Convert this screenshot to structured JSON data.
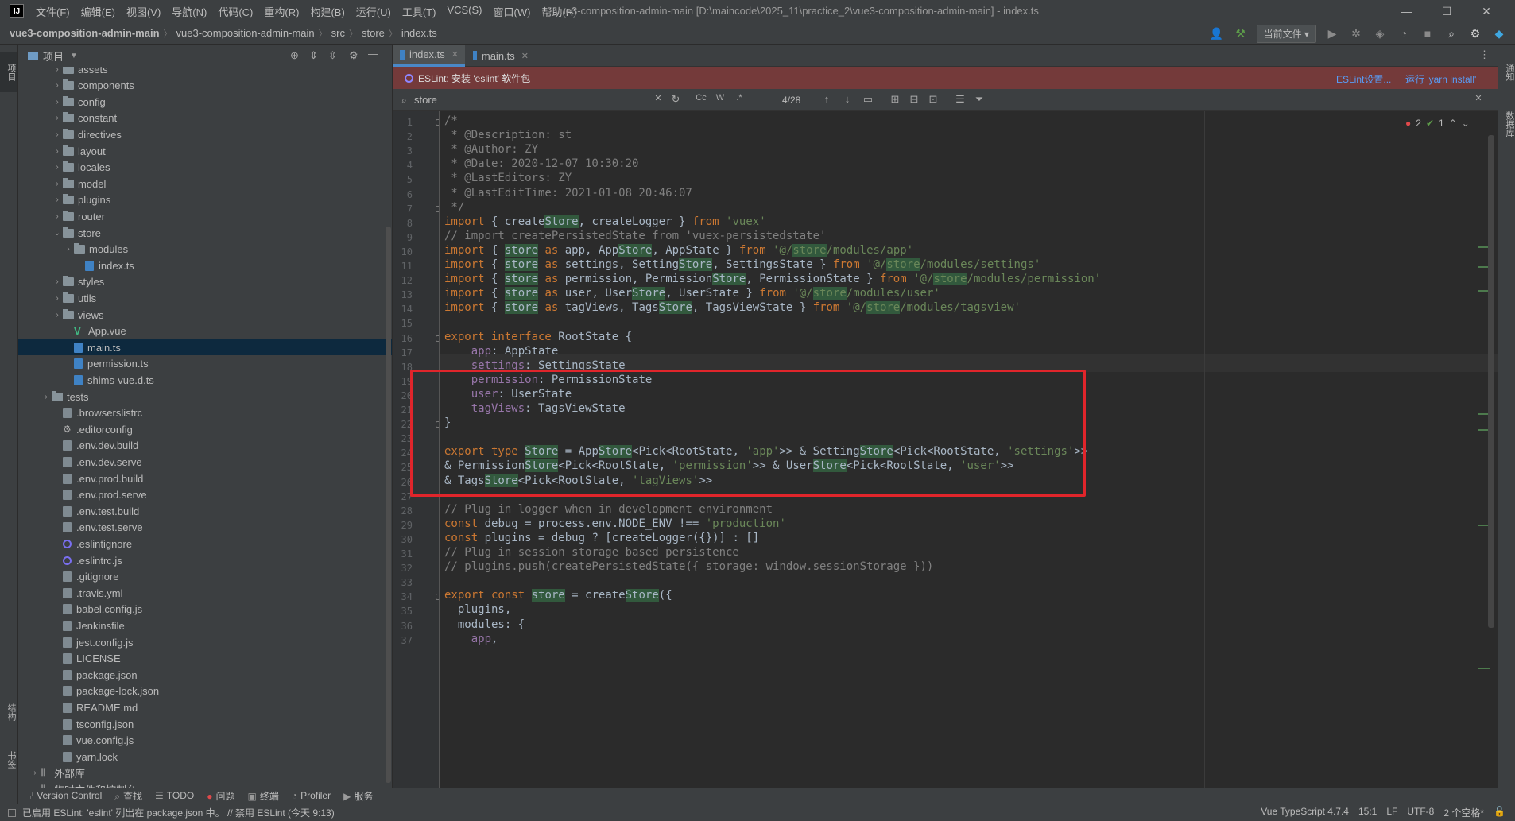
{
  "menu": [
    "文件(F)",
    "编辑(E)",
    "视图(V)",
    "导航(N)",
    "代码(C)",
    "重构(R)",
    "构建(B)",
    "运行(U)",
    "工具(T)",
    "VCS(S)",
    "窗口(W)",
    "帮助(H)"
  ],
  "window_title": "vue3-composition-admin-main [D:\\maincode\\2025_11\\practice_2\\vue3-composition-admin-main] - index.ts",
  "breadcrumb": [
    "vue3-composition-admin-main",
    "vue3-composition-admin-main",
    "src",
    "store",
    "index.ts"
  ],
  "run_config": "当前文件",
  "left_strip": {
    "top": "项目",
    "bottom1": "结构",
    "bottom2": "书签"
  },
  "project": {
    "title": "项目",
    "tree": [
      {
        "label": "assets",
        "kind": "folder",
        "depth": 2,
        "arrow": "›"
      },
      {
        "label": "components",
        "kind": "folder",
        "depth": 2,
        "arrow": "›"
      },
      {
        "label": "config",
        "kind": "folder",
        "depth": 2,
        "arrow": "›"
      },
      {
        "label": "constant",
        "kind": "folder",
        "depth": 2,
        "arrow": "›"
      },
      {
        "label": "directives",
        "kind": "folder",
        "depth": 2,
        "arrow": "›"
      },
      {
        "label": "layout",
        "kind": "folder",
        "depth": 2,
        "arrow": "›"
      },
      {
        "label": "locales",
        "kind": "folder",
        "depth": 2,
        "arrow": "›"
      },
      {
        "label": "model",
        "kind": "folder",
        "depth": 2,
        "arrow": "›"
      },
      {
        "label": "plugins",
        "kind": "folder",
        "depth": 2,
        "arrow": "›"
      },
      {
        "label": "router",
        "kind": "folder",
        "depth": 2,
        "arrow": "›"
      },
      {
        "label": "store",
        "kind": "folder",
        "depth": 2,
        "arrow": "⌄"
      },
      {
        "label": "modules",
        "kind": "folder",
        "depth": 3,
        "arrow": "›"
      },
      {
        "label": "index.ts",
        "kind": "ts",
        "depth": 4,
        "arrow": ""
      },
      {
        "label": "styles",
        "kind": "folder",
        "depth": 2,
        "arrow": "›"
      },
      {
        "label": "utils",
        "kind": "folder",
        "depth": 2,
        "arrow": "›"
      },
      {
        "label": "views",
        "kind": "folder",
        "depth": 2,
        "arrow": "›"
      },
      {
        "label": "App.vue",
        "kind": "vue",
        "depth": 3,
        "arrow": ""
      },
      {
        "label": "main.ts",
        "kind": "ts",
        "depth": 3,
        "arrow": "",
        "selected": true
      },
      {
        "label": "permission.ts",
        "kind": "ts",
        "depth": 3,
        "arrow": ""
      },
      {
        "label": "shims-vue.d.ts",
        "kind": "ts",
        "depth": 3,
        "arrow": ""
      },
      {
        "label": "tests",
        "kind": "folder",
        "depth": 1,
        "arrow": "›"
      },
      {
        "label": ".browserslistrc",
        "kind": "file",
        "depth": 2,
        "arrow": ""
      },
      {
        "label": ".editorconfig",
        "kind": "gear",
        "depth": 2,
        "arrow": ""
      },
      {
        "label": ".env.dev.build",
        "kind": "file",
        "depth": 2,
        "arrow": ""
      },
      {
        "label": ".env.dev.serve",
        "kind": "file",
        "depth": 2,
        "arrow": ""
      },
      {
        "label": ".env.prod.build",
        "kind": "file",
        "depth": 2,
        "arrow": ""
      },
      {
        "label": ".env.prod.serve",
        "kind": "file",
        "depth": 2,
        "arrow": ""
      },
      {
        "label": ".env.test.build",
        "kind": "file",
        "depth": 2,
        "arrow": ""
      },
      {
        "label": ".env.test.serve",
        "kind": "file",
        "depth": 2,
        "arrow": ""
      },
      {
        "label": ".eslintignore",
        "kind": "circle",
        "depth": 2,
        "arrow": ""
      },
      {
        "label": ".eslintrc.js",
        "kind": "circle",
        "depth": 2,
        "arrow": ""
      },
      {
        "label": ".gitignore",
        "kind": "file",
        "depth": 2,
        "arrow": ""
      },
      {
        "label": ".travis.yml",
        "kind": "file",
        "depth": 2,
        "arrow": ""
      },
      {
        "label": "babel.config.js",
        "kind": "file",
        "depth": 2,
        "arrow": ""
      },
      {
        "label": "Jenkinsfile",
        "kind": "file",
        "depth": 2,
        "arrow": ""
      },
      {
        "label": "jest.config.js",
        "kind": "file",
        "depth": 2,
        "arrow": ""
      },
      {
        "label": "LICENSE",
        "kind": "file",
        "depth": 2,
        "arrow": ""
      },
      {
        "label": "package.json",
        "kind": "file",
        "depth": 2,
        "arrow": ""
      },
      {
        "label": "package-lock.json",
        "kind": "file",
        "depth": 2,
        "arrow": ""
      },
      {
        "label": "README.md",
        "kind": "file",
        "depth": 2,
        "arrow": ""
      },
      {
        "label": "tsconfig.json",
        "kind": "file",
        "depth": 2,
        "arrow": ""
      },
      {
        "label": "vue.config.js",
        "kind": "file",
        "depth": 2,
        "arrow": ""
      },
      {
        "label": "yarn.lock",
        "kind": "file",
        "depth": 2,
        "arrow": ""
      },
      {
        "label": "外部库",
        "kind": "lib",
        "depth": 0,
        "arrow": "›"
      },
      {
        "label": "临时文件和控制台",
        "kind": "lib",
        "depth": 0,
        "arrow": "›"
      }
    ]
  },
  "tabs": [
    {
      "label": "index.ts",
      "active": true
    },
    {
      "label": "main.ts",
      "active": false
    }
  ],
  "eslint_bar": {
    "message": "ESLint: 安装 'eslint' 软件包",
    "settings_link": "ESLint设置...",
    "run_link": "运行 'yarn install'"
  },
  "find": {
    "query": "store",
    "count": "4/28"
  },
  "inspections": {
    "errors": "2",
    "warnings": "1"
  },
  "code_lines": [
    {
      "n": "1",
      "html": "<span class=\"cm\">/*</span>"
    },
    {
      "n": "2",
      "html": "<span class=\"cm\"> * @Description: st</span>"
    },
    {
      "n": "3",
      "html": "<span class=\"cm\"> * @Author: ZY</span>"
    },
    {
      "n": "4",
      "html": "<span class=\"cm\"> * @Date: 2020-12-07 10:30:20</span>"
    },
    {
      "n": "5",
      "html": "<span class=\"cm\"> * @LastEditors: ZY</span>"
    },
    {
      "n": "6",
      "html": "<span class=\"cm\"> * @LastEditTime: 2021-01-08 20:46:07</span>"
    },
    {
      "n": "7",
      "html": "<span class=\"cm\"> */</span>"
    },
    {
      "n": "8",
      "html": "<span class=\"kw\">import</span> { create<span class=\"hl\">Store</span>, createLogger } <span class=\"kw\">from</span> <span class=\"str\">'vuex'</span>"
    },
    {
      "n": "9",
      "html": "<span class=\"cm\">// import createPersistedState from 'vuex-persistedstate'</span>"
    },
    {
      "n": "10",
      "html": "<span class=\"kw\">import</span> { <span class=\"hl\">store</span> <span class=\"kw\">as</span> app, App<span class=\"hl\">Store</span>, AppState } <span class=\"kw\">from</span> <span class=\"str\">'@/<span class=\"hl\">store</span>/modules/app'</span>"
    },
    {
      "n": "11",
      "html": "<span class=\"kw\">import</span> { <span class=\"hl\">store</span> <span class=\"kw\">as</span> settings, Setting<span class=\"hl\">Store</span>, SettingsState } <span class=\"kw\">from</span> <span class=\"str\">'@/<span class=\"hl\">store</span>/modules/settings'</span>"
    },
    {
      "n": "12",
      "html": "<span class=\"kw\">import</span> { <span class=\"hl\">store</span> <span class=\"kw\">as</span> permission, Permission<span class=\"hl\">Store</span>, PermissionState } <span class=\"kw\">from</span> <span class=\"str\">'@/<span class=\"hl\">store</span>/modules/permission'</span>"
    },
    {
      "n": "13",
      "html": "<span class=\"kw\">import</span> { <span class=\"hl\">store</span> <span class=\"kw\">as</span> user, User<span class=\"hl\">Store</span>, UserState } <span class=\"kw\">from</span> <span class=\"str\">'@/<span class=\"hl\">store</span>/modules/user'</span>"
    },
    {
      "n": "14",
      "html": "<span class=\"kw\">import</span> { <span class=\"hl\">store</span> <span class=\"kw\">as</span> tagViews, Tags<span class=\"hl\">Store</span>, TagsViewState } <span class=\"kw\">from</span> <span class=\"str\">'@/<span class=\"hl\">store</span>/modules/tagsview'</span>"
    },
    {
      "n": "15",
      "html": ""
    },
    {
      "n": "16",
      "html": "<span class=\"kw\">export interface</span> RootState {"
    },
    {
      "n": "17",
      "html": "    <span class=\"prop\">app</span>: AppState"
    },
    {
      "n": "18",
      "html": "    <span class=\"prop\">settings</span>: SettingsState"
    },
    {
      "n": "19",
      "html": "    <span class=\"prop\">permission</span>: PermissionState"
    },
    {
      "n": "20",
      "html": "    <span class=\"prop\">user</span>: UserState"
    },
    {
      "n": "21",
      "html": "    <span class=\"prop\">tagViews</span>: TagsViewState"
    },
    {
      "n": "22",
      "html": "}"
    },
    {
      "n": "23",
      "html": ""
    },
    {
      "n": "24",
      "html": "<span class=\"kw\">export type</span> <span class=\"hl\">Store</span> = App<span class=\"hl\">Store</span>&lt;Pick&lt;RootState, <span class=\"str\">'app'</span>&gt;&gt; &amp; Setting<span class=\"hl\">Store</span>&lt;Pick&lt;RootState, <span class=\"str\">'settings'</span>&gt;&gt;"
    },
    {
      "n": "25",
      "html": "&amp; Permission<span class=\"hl\">Store</span>&lt;Pick&lt;RootState, <span class=\"str\">'permission'</span>&gt;&gt; &amp; User<span class=\"hl\">Store</span>&lt;Pick&lt;RootState, <span class=\"str\">'user'</span>&gt;&gt;"
    },
    {
      "n": "26",
      "html": "&amp; Tags<span class=\"hl\">Store</span>&lt;Pick&lt;RootState, <span class=\"str\">'tagViews'</span>&gt;&gt;"
    },
    {
      "n": "27",
      "html": ""
    },
    {
      "n": "28",
      "html": "<span class=\"cm\">// Plug in logger when in development environment</span>"
    },
    {
      "n": "29",
      "html": "<span class=\"kw\">const</span> debug = process.env.NODE_ENV !== <span class=\"str\">'production'</span>"
    },
    {
      "n": "30",
      "html": "<span class=\"kw\">const</span> plugins = debug ? [createLogger({})] : []"
    },
    {
      "n": "31",
      "html": "<span class=\"cm\">// Plug in session storage based persistence</span>"
    },
    {
      "n": "32",
      "html": "<span class=\"cm\">// plugins.push(createPersistedState({ storage: window.sessionStorage }))</span>"
    },
    {
      "n": "33",
      "html": ""
    },
    {
      "n": "34",
      "html": "<span class=\"kw\">export const</span> <span class=\"hl\">store</span> = create<span class=\"hl\">Store</span>({"
    },
    {
      "n": "35",
      "html": "  plugins,"
    },
    {
      "n": "36",
      "html": "  modules: {"
    },
    {
      "n": "37",
      "html": "    <span class=\"prop\">app</span>,"
    }
  ],
  "toolwindows": [
    "Version Control",
    "查找",
    "TODO",
    "问题",
    "终端",
    "Profiler",
    "服务"
  ],
  "status": {
    "message": "已启用 ESLint: 'eslint' 列出在 package.json 中。 // 禁用 ESLint (今天 9:13)",
    "right": [
      "Vue TypeScript 4.7.4",
      "15:1",
      "LF",
      "UTF-8",
      "2 个空格*"
    ]
  }
}
